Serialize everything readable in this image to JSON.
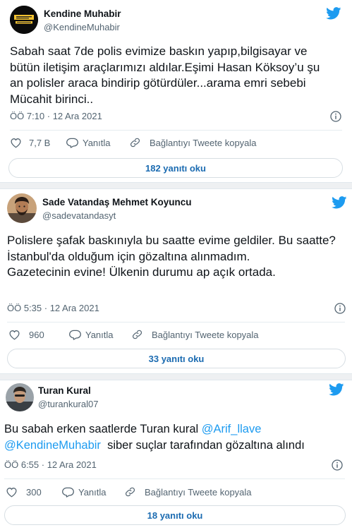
{
  "colors": {
    "accent": "#1d9bf0",
    "muted": "#536471",
    "text": "#0f1419"
  },
  "tweets": [
    {
      "name": "Kendine Muhabir",
      "handle": "@KendineMuhabir",
      "avatar_icon": "kendine-muhabir-logo",
      "text": "Sabah saat 7de polis evimize baskın yapıp,bilgisayar ve bütün iletişim araçlarımızı aldılar.Eşimi Hasan Köksoy’u şu an polisler araca bindirip götürdüler...arama emri sebebi Mücahit birinci..",
      "timestamp": "ÖÖ 7:10 · 12 Ara 2021",
      "likes": "7,7 B",
      "reply_label": "Yanıtla",
      "copy_label": "Bağlantıyı Tweete kopyala",
      "read_replies": "182 yanıtı oku"
    },
    {
      "name": "Sade Vatandaş Mehmet Koyuncu",
      "handle": "@sadevatandasyt",
      "avatar_icon": "profile-photo",
      "text_lines": [
        "Polislere şafak baskınıyla bu saatte evime geldiler. Bu saatte?",
        "İstanbul'da olduğum için gözaltına alınmadım.",
        "Gazetecinin evine! Ülkenin durumu ap açık ortada."
      ],
      "timestamp": "ÖÖ 5:35 · 12 Ara 2021",
      "likes": "960",
      "reply_label": "Yanıtla",
      "copy_label": "Bağlantıyı Tweete kopyala",
      "read_replies": "33 yanıtı oku"
    },
    {
      "name": "Turan Kural",
      "handle": "@turankural07",
      "avatar_icon": "profile-photo",
      "text_prefix": "Bu sabah erken saatlerde Turan kural ",
      "mention1": "@Arif_llave",
      "mention2": "@KendineMuhabir",
      "text_suffix": "  siber suçlar tarafından gözaltına alındı",
      "timestamp": "ÖÖ 6:55 · 12 Ara 2021",
      "likes": "300",
      "reply_label": "Yanıtla",
      "copy_label": "Bağlantıyı Tweete kopyala",
      "read_replies": "18 yanıtı oku"
    }
  ]
}
